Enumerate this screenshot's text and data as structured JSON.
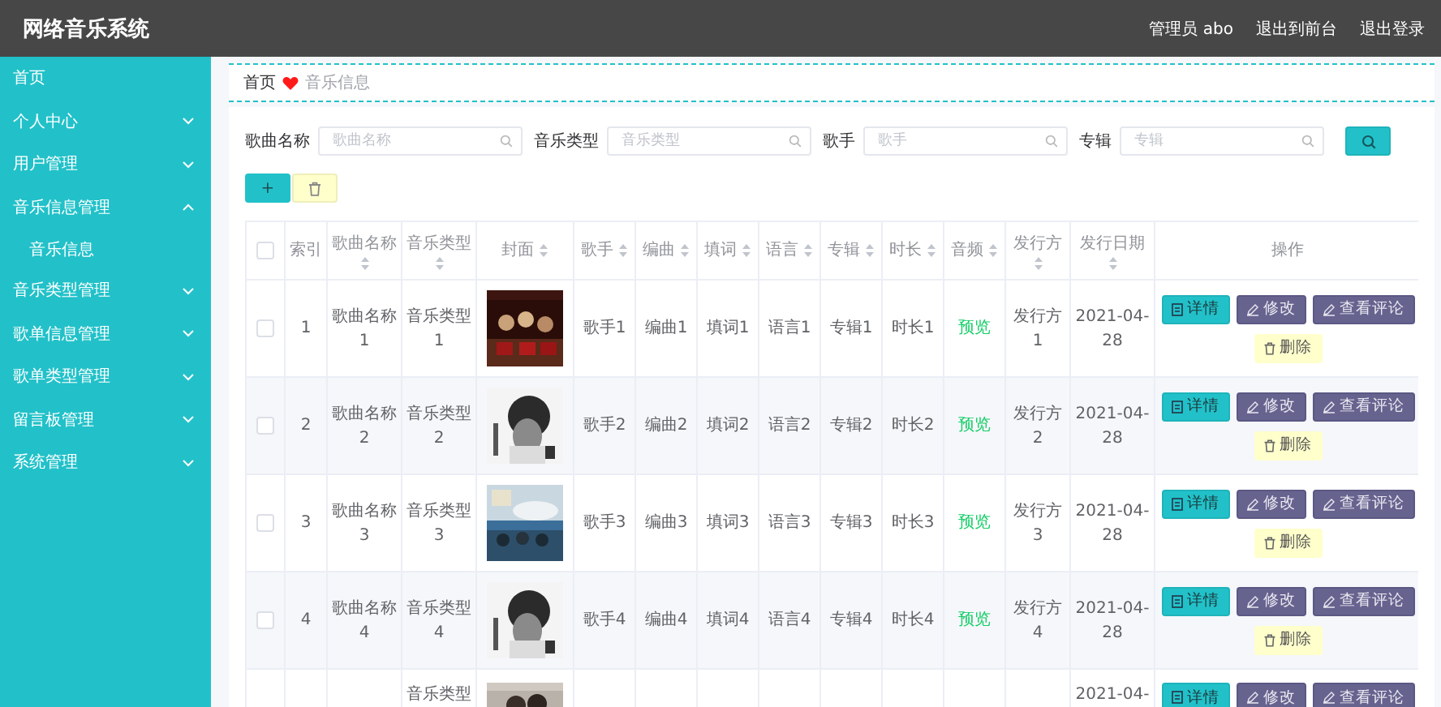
{
  "header": {
    "title": "网络音乐系统",
    "links": [
      "管理员 abo",
      "退出到前台",
      "退出登录"
    ]
  },
  "sidebar": {
    "items": [
      {
        "label": "首页"
      },
      {
        "label": "个人中心",
        "expanded": false
      },
      {
        "label": "用户管理",
        "expanded": false
      },
      {
        "label": "音乐信息管理",
        "expanded": true,
        "children": [
          {
            "label": "音乐信息"
          }
        ]
      },
      {
        "label": "音乐类型管理",
        "expanded": false
      },
      {
        "label": "歌单信息管理",
        "expanded": false
      },
      {
        "label": "歌单类型管理",
        "expanded": false
      },
      {
        "label": "留言板管理",
        "expanded": false
      },
      {
        "label": "系统管理",
        "expanded": false
      }
    ]
  },
  "breadcrumb": [
    "首页",
    "音乐信息"
  ],
  "search": {
    "fields": [
      {
        "label": "歌曲名称",
        "placeholder": "歌曲名称"
      },
      {
        "label": "音乐类型",
        "placeholder": "音乐类型"
      },
      {
        "label": "歌手",
        "placeholder": "歌手"
      },
      {
        "label": "专辑",
        "placeholder": "专辑"
      }
    ]
  },
  "toolbar": {
    "add_label": "+"
  },
  "table": {
    "select_all_checked": false,
    "columns": [
      {
        "label": "索引",
        "sortable": false
      },
      {
        "label": "歌曲名称",
        "sortable": true
      },
      {
        "label": "音乐类型",
        "sortable": true
      },
      {
        "label": "封面",
        "sortable": true
      },
      {
        "label": "歌手",
        "sortable": true
      },
      {
        "label": "编曲",
        "sortable": true
      },
      {
        "label": "填词",
        "sortable": true
      },
      {
        "label": "语言",
        "sortable": true
      },
      {
        "label": "专辑",
        "sortable": true
      },
      {
        "label": "时长",
        "sortable": true
      },
      {
        "label": "音频",
        "sortable": true
      },
      {
        "label": "发行方",
        "sortable": true
      },
      {
        "label": "发行日期",
        "sortable": true
      },
      {
        "label": "操作",
        "sortable": false
      }
    ],
    "rows": [
      {
        "checked": false,
        "index": "1",
        "name": "歌曲名称1",
        "type": "音乐类型1",
        "cover": {
          "kind": "picture"
        },
        "singer": "歌手1",
        "composer": "编曲1",
        "lyricist": "填词1",
        "language": "语言1",
        "album": "专辑1",
        "duration": "时长1",
        "audio": "预览",
        "publisher": "发行方1",
        "date": "2021-04-28",
        "actions": [
          {
            "label": "详情",
            "kind": "detail"
          },
          {
            "label": "修改",
            "kind": "edit"
          },
          {
            "label": "查看评论",
            "kind": "edit"
          },
          {
            "label": "删除",
            "kind": "delete"
          }
        ]
      },
      {
        "checked": false,
        "index": "2",
        "name": "歌曲名称2",
        "type": "音乐类型2",
        "cover": {
          "kind": "picture"
        },
        "singer": "歌手2",
        "composer": "编曲2",
        "lyricist": "填词2",
        "language": "语言2",
        "album": "专辑2",
        "duration": "时长2",
        "audio": "预览",
        "publisher": "发行方2",
        "date": "2021-04-28",
        "actions": [
          {
            "label": "详情",
            "kind": "detail"
          },
          {
            "label": "修改",
            "kind": "edit"
          },
          {
            "label": "查看评论",
            "kind": "edit"
          },
          {
            "label": "删除",
            "kind": "delete"
          }
        ]
      },
      {
        "checked": false,
        "index": "3",
        "name": "歌曲名称3",
        "type": "音乐类型3",
        "cover": {
          "kind": "picture"
        },
        "singer": "歌手3",
        "composer": "编曲3",
        "lyricist": "填词3",
        "language": "语言3",
        "album": "专辑3",
        "duration": "时长3",
        "audio": "预览",
        "publisher": "发行方3",
        "date": "2021-04-28",
        "actions": [
          {
            "label": "详情",
            "kind": "detail"
          },
          {
            "label": "修改",
            "kind": "edit"
          },
          {
            "label": "查看评论",
            "kind": "edit"
          },
          {
            "label": "删除",
            "kind": "delete"
          }
        ]
      },
      {
        "checked": false,
        "index": "4",
        "name": "歌曲名称4",
        "type": "音乐类型4",
        "cover": {
          "kind": "picture"
        },
        "singer": "歌手4",
        "composer": "编曲4",
        "lyricist": "填词4",
        "language": "语言4",
        "album": "专辑4",
        "duration": "时长4",
        "audio": "预览",
        "publisher": "发行方4",
        "date": "2021-04-28",
        "actions": [
          {
            "label": "详情",
            "kind": "detail"
          },
          {
            "label": "修改",
            "kind": "edit"
          },
          {
            "label": "查看评论",
            "kind": "edit"
          },
          {
            "label": "删除",
            "kind": "delete"
          }
        ]
      },
      {
        "type": "音乐类型",
        "cover": {
          "kind": "picture"
        },
        "date": "2021-04-",
        "actions": [
          {
            "label": "详情",
            "kind": "detail"
          },
          {
            "label": "修改",
            "kind": "edit"
          },
          {
            "label": "查看评论",
            "kind": "edit"
          }
        ]
      }
    ]
  }
}
